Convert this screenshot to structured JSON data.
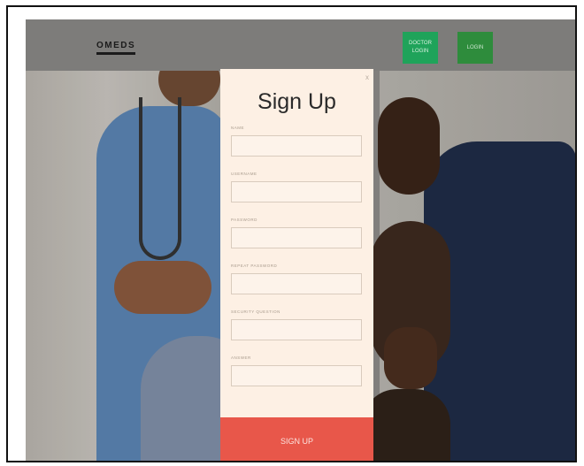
{
  "header": {
    "logo": "OMEDS",
    "doctor_login_line1": "DOCTOR",
    "doctor_login_line2": "LOGIN",
    "login": "LOGIN"
  },
  "modal": {
    "title": "Sign Up",
    "close": "x",
    "fields": [
      {
        "label": "NAME",
        "value": "",
        "placeholder": ""
      },
      {
        "label": "USERNAME",
        "value": "",
        "placeholder": ""
      },
      {
        "label": "PASSWORD",
        "value": "",
        "placeholder": ""
      },
      {
        "label": "REPEAT PASSWORD",
        "value": "",
        "placeholder": ""
      },
      {
        "label": "SECURITY QUESTION",
        "value": "",
        "placeholder": ""
      },
      {
        "label": "ANSWER",
        "value": "",
        "placeholder": ""
      }
    ],
    "submit": "SIGN UP"
  },
  "colors": {
    "accent": "#e8574a",
    "doctor_button": "#1fa35a",
    "login_button": "#2e8c3c",
    "modal_bg": "#fdf0e4"
  }
}
